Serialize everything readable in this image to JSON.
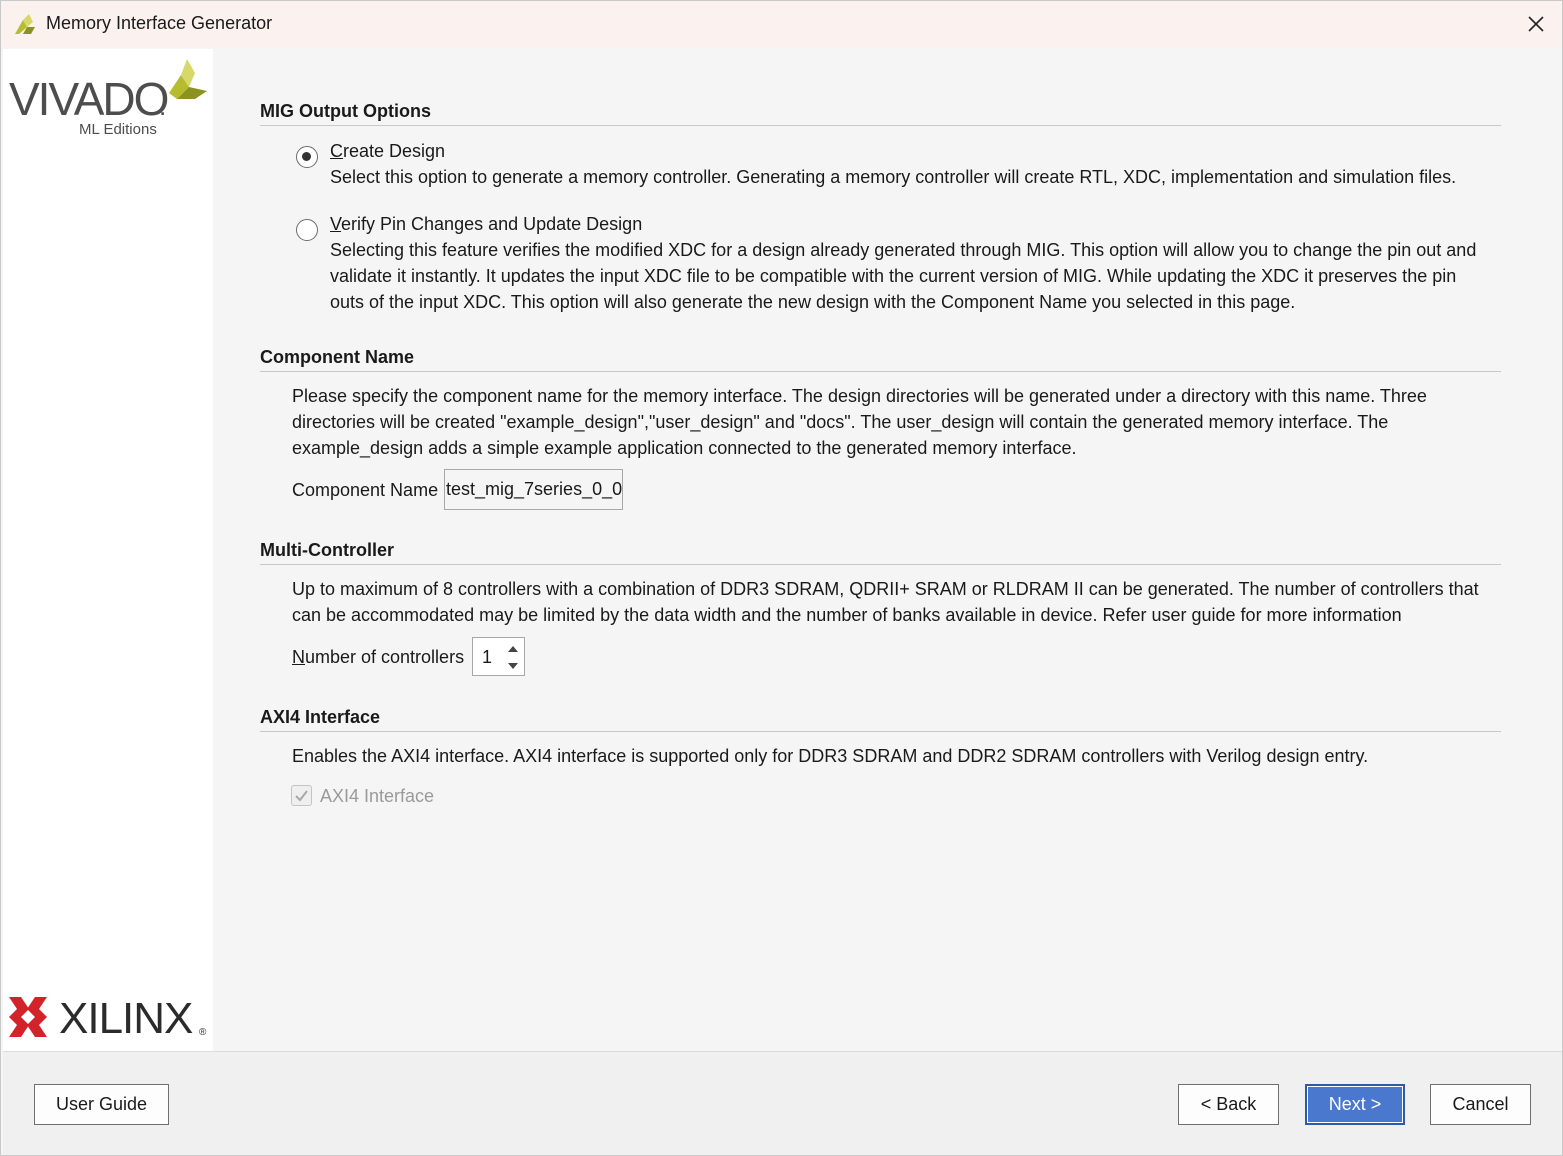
{
  "window": {
    "title": "Memory Interface Generator"
  },
  "sidebar": {
    "top_logo": {
      "text": "VIVADO",
      "subtext": "ML Editions",
      "mark": "."
    },
    "bottom_logo": {
      "text": "XILINX",
      "mark": "®"
    }
  },
  "output_options": {
    "title": "MIG Output Options",
    "options": [
      {
        "label": "Create Design",
        "selected": true,
        "description": "Select this option to generate a memory controller. Generating a memory controller will create RTL, XDC, implementation and simulation files."
      },
      {
        "label": "Verify Pin Changes and Update Design",
        "selected": false,
        "description": "Selecting this feature verifies the modified XDC for a design already generated through MIG. This option will allow you to change the pin out and validate it instantly. It updates the input XDC file to be compatible with the current version of MIG. While updating the XDC it preserves the pin outs of the input XDC. This option will also generate the new design with the Component Name you selected in this page."
      }
    ]
  },
  "component_name": {
    "title": "Component Name",
    "description": "Please specify the component name for the memory interface. The design directories will be generated under a directory with this name. Three directories will be created \"example_design\",\"user_design\" and \"docs\". The user_design will contain the generated memory interface. The example_design adds a simple example application connected to the generated memory interface.",
    "field_label": "Component Name",
    "value": "test_mig_7series_0_0"
  },
  "multi_controller": {
    "title": "Multi-Controller",
    "description": "Up to maximum of 8 controllers with a combination of DDR3 SDRAM, QDRII+ SRAM or RLDRAM II can be generated. The number of controllers that can be accommodated may be limited by the data width and the number of banks available in device. Refer user guide for more information",
    "field_label": "Number of controllers",
    "value": "1"
  },
  "axi4": {
    "title": "AXI4 Interface",
    "description": "Enables the AXI4 interface. AXI4 interface is supported only for DDR3 SDRAM and DDR2 SDRAM controllers with Verilog design entry.",
    "checkbox_label": "AXI4 Interface",
    "checked": true,
    "disabled": true
  },
  "footer": {
    "user_guide": "User Guide",
    "back": "< Back",
    "next": "Next >",
    "cancel": "Cancel"
  },
  "colors": {
    "accent": "#4a78cf",
    "xilinx_red": "#d2232a",
    "vivado_green": "#b5bd2f"
  }
}
